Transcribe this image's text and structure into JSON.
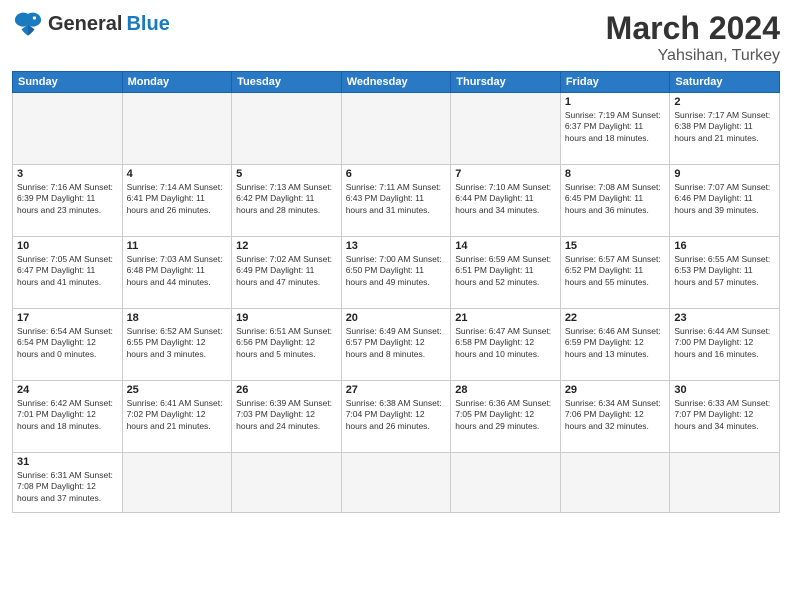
{
  "header": {
    "logo": {
      "general": "General",
      "blue": "Blue"
    },
    "title": "March 2024",
    "subtitle": "Yahsihan, Turkey"
  },
  "weekdays": [
    "Sunday",
    "Monday",
    "Tuesday",
    "Wednesday",
    "Thursday",
    "Friday",
    "Saturday"
  ],
  "weeks": [
    [
      {
        "day": "",
        "info": ""
      },
      {
        "day": "",
        "info": ""
      },
      {
        "day": "",
        "info": ""
      },
      {
        "day": "",
        "info": ""
      },
      {
        "day": "",
        "info": ""
      },
      {
        "day": "1",
        "info": "Sunrise: 7:19 AM\nSunset: 6:37 PM\nDaylight: 11 hours and 18 minutes."
      },
      {
        "day": "2",
        "info": "Sunrise: 7:17 AM\nSunset: 6:38 PM\nDaylight: 11 hours and 21 minutes."
      }
    ],
    [
      {
        "day": "3",
        "info": "Sunrise: 7:16 AM\nSunset: 6:39 PM\nDaylight: 11 hours and 23 minutes."
      },
      {
        "day": "4",
        "info": "Sunrise: 7:14 AM\nSunset: 6:41 PM\nDaylight: 11 hours and 26 minutes."
      },
      {
        "day": "5",
        "info": "Sunrise: 7:13 AM\nSunset: 6:42 PM\nDaylight: 11 hours and 28 minutes."
      },
      {
        "day": "6",
        "info": "Sunrise: 7:11 AM\nSunset: 6:43 PM\nDaylight: 11 hours and 31 minutes."
      },
      {
        "day": "7",
        "info": "Sunrise: 7:10 AM\nSunset: 6:44 PM\nDaylight: 11 hours and 34 minutes."
      },
      {
        "day": "8",
        "info": "Sunrise: 7:08 AM\nSunset: 6:45 PM\nDaylight: 11 hours and 36 minutes."
      },
      {
        "day": "9",
        "info": "Sunrise: 7:07 AM\nSunset: 6:46 PM\nDaylight: 11 hours and 39 minutes."
      }
    ],
    [
      {
        "day": "10",
        "info": "Sunrise: 7:05 AM\nSunset: 6:47 PM\nDaylight: 11 hours and 41 minutes."
      },
      {
        "day": "11",
        "info": "Sunrise: 7:03 AM\nSunset: 6:48 PM\nDaylight: 11 hours and 44 minutes."
      },
      {
        "day": "12",
        "info": "Sunrise: 7:02 AM\nSunset: 6:49 PM\nDaylight: 11 hours and 47 minutes."
      },
      {
        "day": "13",
        "info": "Sunrise: 7:00 AM\nSunset: 6:50 PM\nDaylight: 11 hours and 49 minutes."
      },
      {
        "day": "14",
        "info": "Sunrise: 6:59 AM\nSunset: 6:51 PM\nDaylight: 11 hours and 52 minutes."
      },
      {
        "day": "15",
        "info": "Sunrise: 6:57 AM\nSunset: 6:52 PM\nDaylight: 11 hours and 55 minutes."
      },
      {
        "day": "16",
        "info": "Sunrise: 6:55 AM\nSunset: 6:53 PM\nDaylight: 11 hours and 57 minutes."
      }
    ],
    [
      {
        "day": "17",
        "info": "Sunrise: 6:54 AM\nSunset: 6:54 PM\nDaylight: 12 hours and 0 minutes."
      },
      {
        "day": "18",
        "info": "Sunrise: 6:52 AM\nSunset: 6:55 PM\nDaylight: 12 hours and 3 minutes."
      },
      {
        "day": "19",
        "info": "Sunrise: 6:51 AM\nSunset: 6:56 PM\nDaylight: 12 hours and 5 minutes."
      },
      {
        "day": "20",
        "info": "Sunrise: 6:49 AM\nSunset: 6:57 PM\nDaylight: 12 hours and 8 minutes."
      },
      {
        "day": "21",
        "info": "Sunrise: 6:47 AM\nSunset: 6:58 PM\nDaylight: 12 hours and 10 minutes."
      },
      {
        "day": "22",
        "info": "Sunrise: 6:46 AM\nSunset: 6:59 PM\nDaylight: 12 hours and 13 minutes."
      },
      {
        "day": "23",
        "info": "Sunrise: 6:44 AM\nSunset: 7:00 PM\nDaylight: 12 hours and 16 minutes."
      }
    ],
    [
      {
        "day": "24",
        "info": "Sunrise: 6:42 AM\nSunset: 7:01 PM\nDaylight: 12 hours and 18 minutes."
      },
      {
        "day": "25",
        "info": "Sunrise: 6:41 AM\nSunset: 7:02 PM\nDaylight: 12 hours and 21 minutes."
      },
      {
        "day": "26",
        "info": "Sunrise: 6:39 AM\nSunset: 7:03 PM\nDaylight: 12 hours and 24 minutes."
      },
      {
        "day": "27",
        "info": "Sunrise: 6:38 AM\nSunset: 7:04 PM\nDaylight: 12 hours and 26 minutes."
      },
      {
        "day": "28",
        "info": "Sunrise: 6:36 AM\nSunset: 7:05 PM\nDaylight: 12 hours and 29 minutes."
      },
      {
        "day": "29",
        "info": "Sunrise: 6:34 AM\nSunset: 7:06 PM\nDaylight: 12 hours and 32 minutes."
      },
      {
        "day": "30",
        "info": "Sunrise: 6:33 AM\nSunset: 7:07 PM\nDaylight: 12 hours and 34 minutes."
      }
    ],
    [
      {
        "day": "31",
        "info": "Sunrise: 6:31 AM\nSunset: 7:08 PM\nDaylight: 12 hours and 37 minutes."
      },
      {
        "day": "",
        "info": ""
      },
      {
        "day": "",
        "info": ""
      },
      {
        "day": "",
        "info": ""
      },
      {
        "day": "",
        "info": ""
      },
      {
        "day": "",
        "info": ""
      },
      {
        "day": "",
        "info": ""
      }
    ]
  ]
}
